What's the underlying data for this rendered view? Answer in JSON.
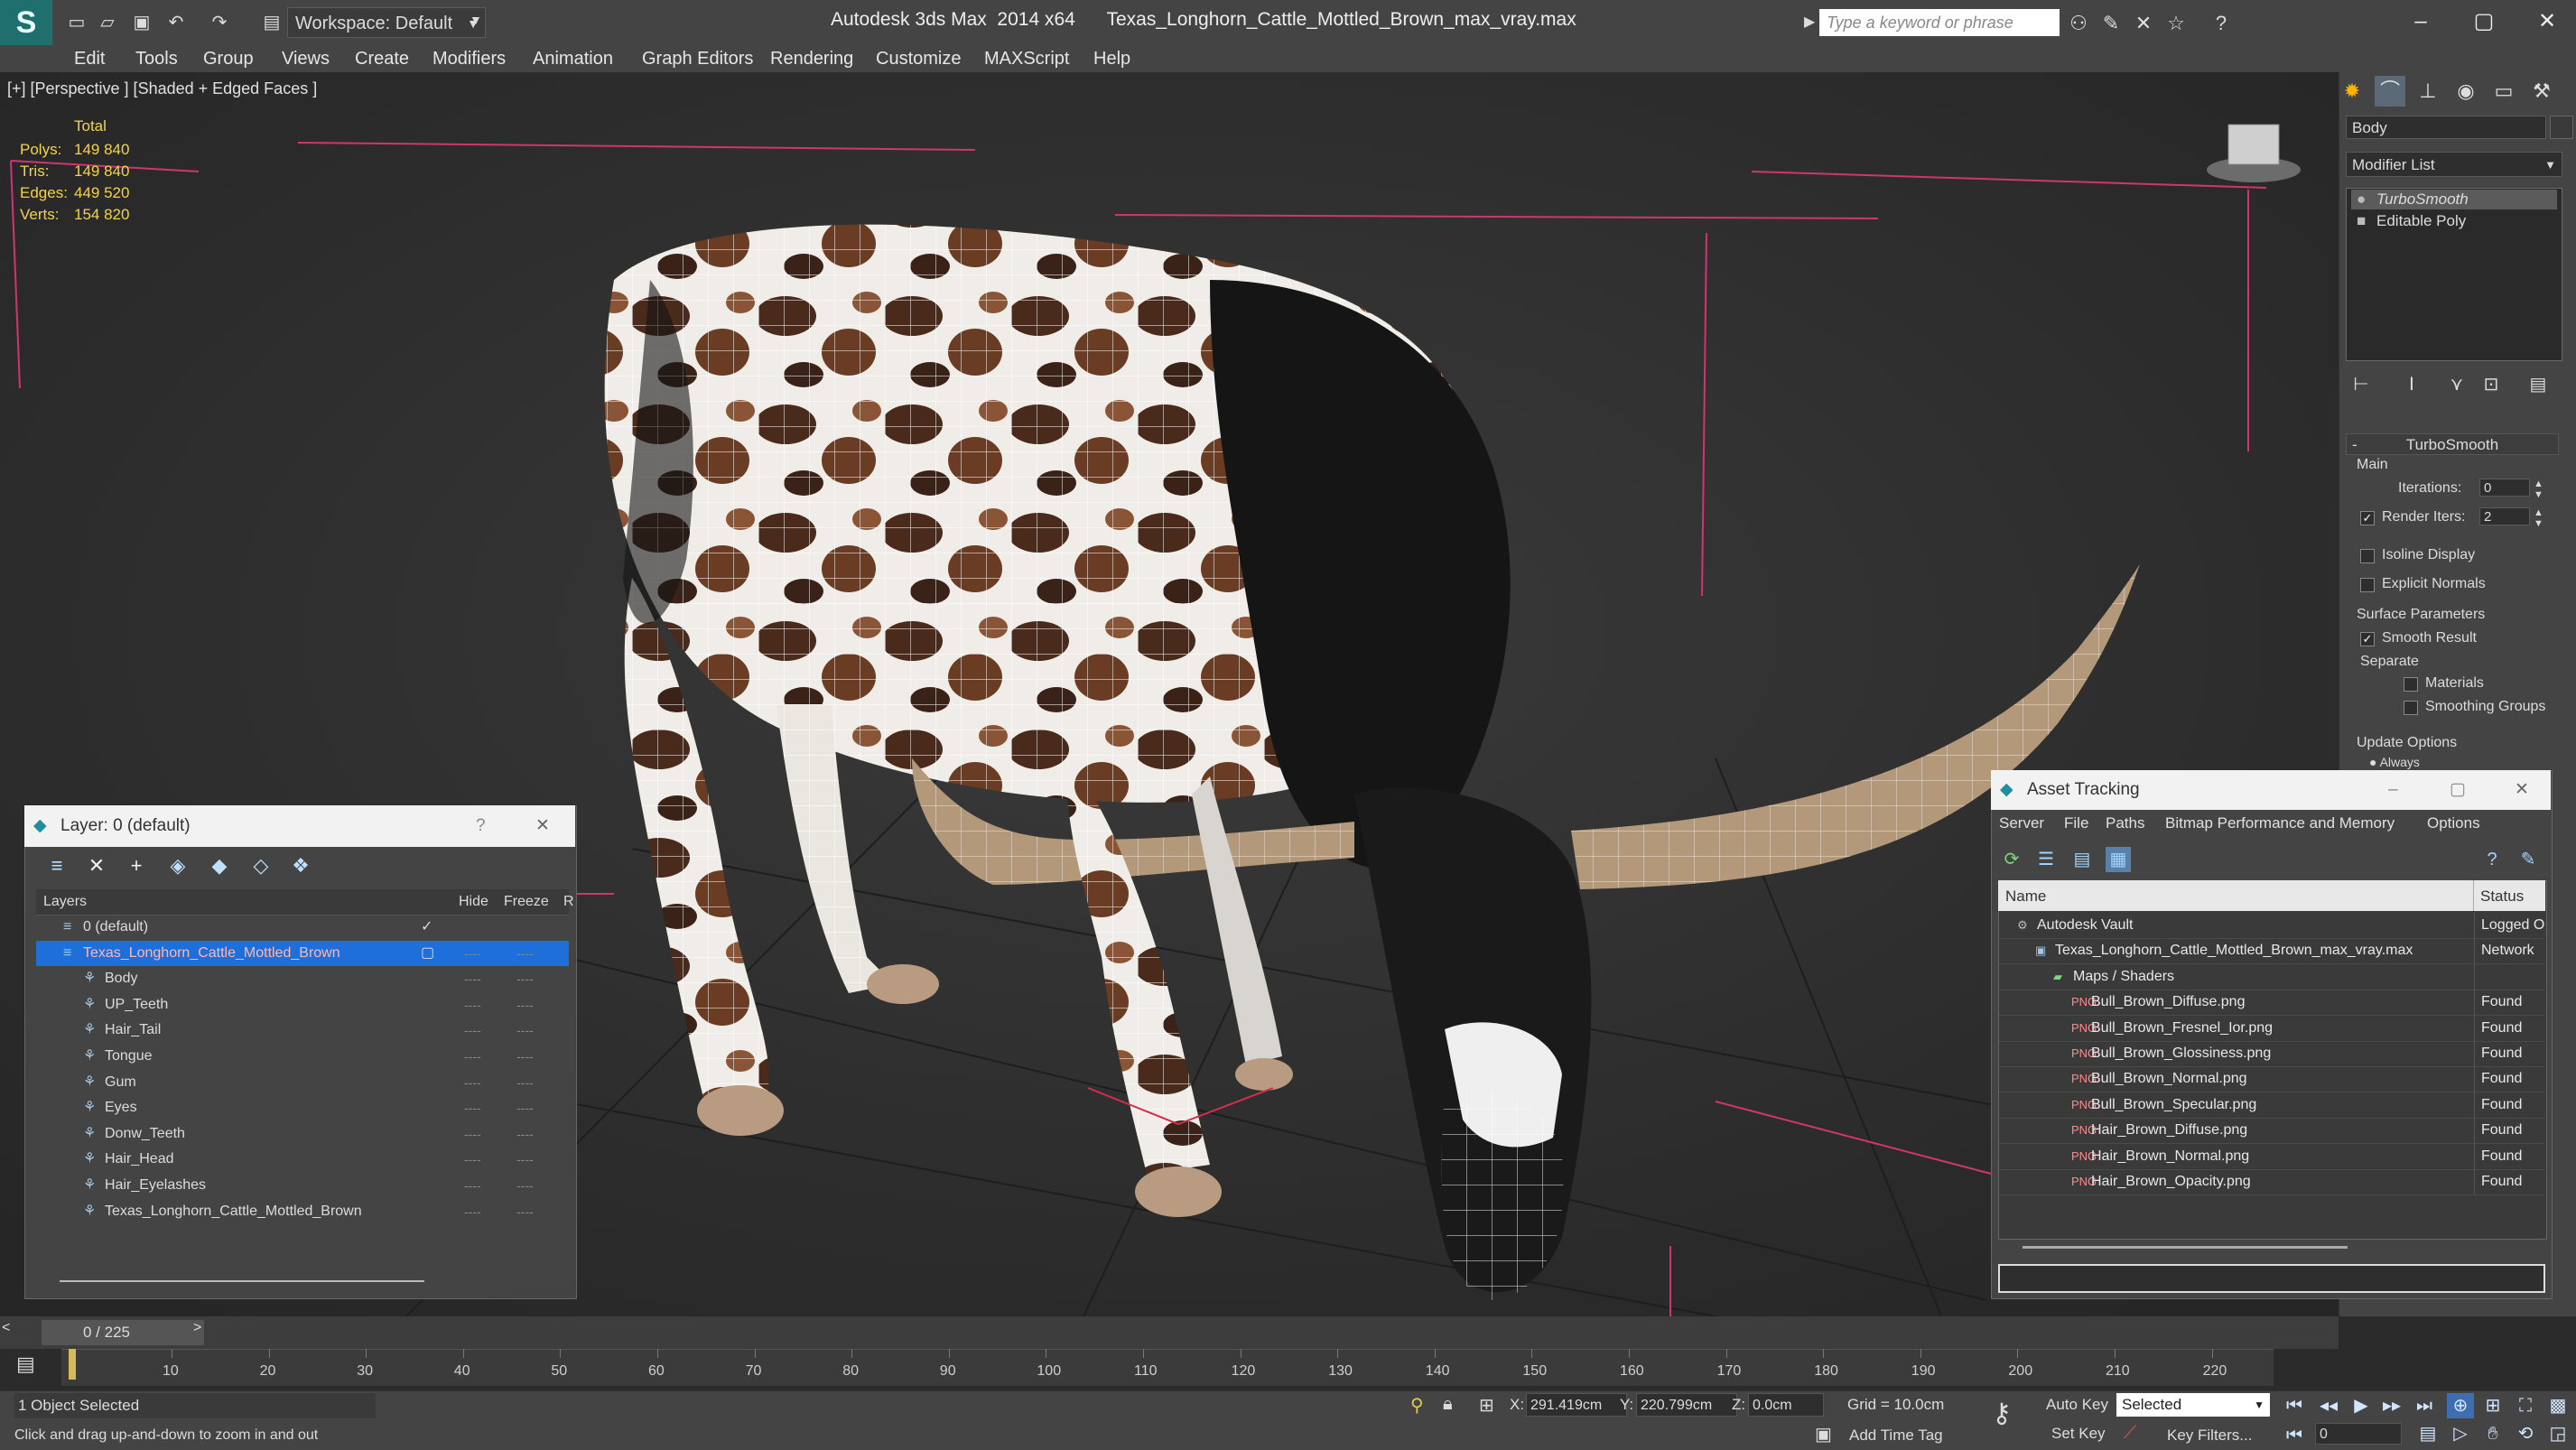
{
  "window": {
    "app": "Autodesk 3ds Max  2014 x64",
    "file": "Texas_Longhorn_Cattle_Mottled_Brown_max_vray.max",
    "workspace": "Workspace: Default",
    "search_placeholder": "Type a keyword or phrase"
  },
  "menu": [
    "Edit",
    "Tools",
    "Group",
    "Views",
    "Create",
    "Modifiers",
    "Animation",
    "Graph Editors",
    "Rendering",
    "Customize",
    "MAXScript",
    "Help"
  ],
  "viewport": {
    "label": "[+] [Perspective ] [Shaded + Edged Faces ]",
    "stats_header": "Total",
    "stats": [
      {
        "label": "Polys:",
        "value": "149 840"
      },
      {
        "label": "Tris:",
        "value": "149 840"
      },
      {
        "label": "Edges:",
        "value": "449 520"
      },
      {
        "label": "Verts:",
        "value": "154 820"
      }
    ]
  },
  "command_panel": {
    "object_name": "Body",
    "modifier_list": "Modifier List",
    "stack": [
      "TurboSmooth",
      "Editable Poly"
    ],
    "turbosmooth": {
      "title": "TurboSmooth",
      "main": "Main",
      "iterations_label": "Iterations:",
      "iterations": "0",
      "render_iters_label": "Render Iters:",
      "render_iters": "2",
      "isoline": "Isoline Display",
      "explicit_normals": "Explicit Normals",
      "surface_params": "Surface Parameters",
      "smooth_result": "Smooth Result",
      "separate": "Separate",
      "materials": "Materials",
      "smoothing_groups": "Smoothing Groups",
      "update_options": "Update Options",
      "always": "Always"
    }
  },
  "layer_dialog": {
    "title": "Layer: 0 (default)",
    "help": "?",
    "col_layers": "Layers",
    "col_hide": "Hide",
    "col_freeze": "Freeze",
    "col_render": "R",
    "rows": [
      {
        "name": "0 (default)",
        "indent": 0,
        "selected": false
      },
      {
        "name": "Texas_Longhorn_Cattle_Mottled_Brown",
        "indent": 0,
        "selected": true
      },
      {
        "name": "Body",
        "indent": 1,
        "selected": false
      },
      {
        "name": "UP_Teeth",
        "indent": 1,
        "selected": false
      },
      {
        "name": "Hair_Tail",
        "indent": 1,
        "selected": false
      },
      {
        "name": "Tongue",
        "indent": 1,
        "selected": false
      },
      {
        "name": "Gum",
        "indent": 1,
        "selected": false
      },
      {
        "name": "Eyes",
        "indent": 1,
        "selected": false
      },
      {
        "name": "Donw_Teeth",
        "indent": 1,
        "selected": false
      },
      {
        "name": "Hair_Head",
        "indent": 1,
        "selected": false
      },
      {
        "name": "Hair_Eyelashes",
        "indent": 1,
        "selected": false
      },
      {
        "name": "Texas_Longhorn_Cattle_Mottled_Brown",
        "indent": 1,
        "selected": false
      }
    ],
    "dots": "----"
  },
  "asset_dialog": {
    "title": "Asset Tracking",
    "menu": [
      "Server",
      "File",
      "Paths",
      "Bitmap Performance and Memory",
      "Options"
    ],
    "col_name": "Name",
    "col_status": "Status",
    "rows": [
      {
        "name": "Autodesk Vault",
        "status": "Logged O",
        "indent": 1
      },
      {
        "name": "Texas_Longhorn_Cattle_Mottled_Brown_max_vray.max",
        "status": "Network",
        "indent": 2
      },
      {
        "name": "Maps / Shaders",
        "status": "",
        "indent": 3
      },
      {
        "name": "Bull_Brown_Diffuse.png",
        "status": "Found",
        "indent": 4
      },
      {
        "name": "Bull_Brown_Fresnel_Ior.png",
        "status": "Found",
        "indent": 4
      },
      {
        "name": "Bull_Brown_Glossiness.png",
        "status": "Found",
        "indent": 4
      },
      {
        "name": "Bull_Brown_Normal.png",
        "status": "Found",
        "indent": 4
      },
      {
        "name": "Bull_Brown_Specular.png",
        "status": "Found",
        "indent": 4
      },
      {
        "name": "Hair_Brown_Diffuse.png",
        "status": "Found",
        "indent": 4
      },
      {
        "name": "Hair_Brown_Normal.png",
        "status": "Found",
        "indent": 4
      },
      {
        "name": "Hair_Brown_Opacity.png",
        "status": "Found",
        "indent": 4
      }
    ]
  },
  "timeline": {
    "frame": "0 / 225",
    "ticks": [
      "10",
      "20",
      "30",
      "40",
      "50",
      "60",
      "70",
      "80",
      "90",
      "100",
      "110",
      "120",
      "130",
      "140",
      "150",
      "160",
      "170",
      "180",
      "190",
      "200",
      "210",
      "220"
    ]
  },
  "status": {
    "selection": "1 Object Selected",
    "prompt": "Click and drag up-and-down to zoom in and out",
    "x_label": "X:",
    "x": "291.419cm",
    "y_label": "Y:",
    "y": "220.799cm",
    "z_label": "Z:",
    "z": "0.0cm",
    "grid": "Grid = 10.0cm",
    "add_time_tag": "Add Time Tag",
    "auto_key": "Auto Key",
    "set_key": "Set Key",
    "selected": "Selected",
    "key_filters": "Key Filters...",
    "current_frame": "0"
  },
  "colors": {
    "stats_yellow": "#f4d34a",
    "selection_blue": "#1e6fd9",
    "grid_pink": "#d0356f"
  }
}
